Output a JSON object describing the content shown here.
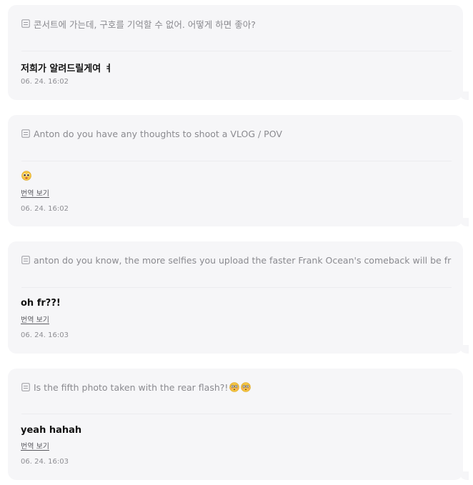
{
  "messages": [
    {
      "question": "콘서트에 가는데, 구호를 기억할 수 없어. 어떻게 하면 좋아?",
      "answer": "저희가 알려드릴게여 ㅕ",
      "translate_label": "",
      "time": "06. 24. 16:02"
    },
    {
      "question": "Anton do you have any thoughts to shoot a VLOG / POV",
      "answer_emoji": "pleading-face-emoji",
      "translate_label": "번역 보기",
      "time": "06. 24. 16:02"
    },
    {
      "question": "anton do you know, the more selfies you upload the faster Frank Ocean's comeback will be fr",
      "answer": "oh fr??!",
      "translate_label": "번역 보기",
      "time": "06. 24. 16:03"
    },
    {
      "question": "Is the fifth photo taken with the rear flash?!",
      "question_emojis": [
        "flushed-face-emoji",
        "flushed-face-emoji"
      ],
      "answer": "yeah hahah",
      "translate_label": "번역 보기",
      "time": "06. 24. 16:03"
    }
  ],
  "colors": {
    "card_bg": "#f6f6f8",
    "question_text": "#8a8a8f",
    "answer_text": "#111111",
    "timestamp": "#8e8e93"
  }
}
